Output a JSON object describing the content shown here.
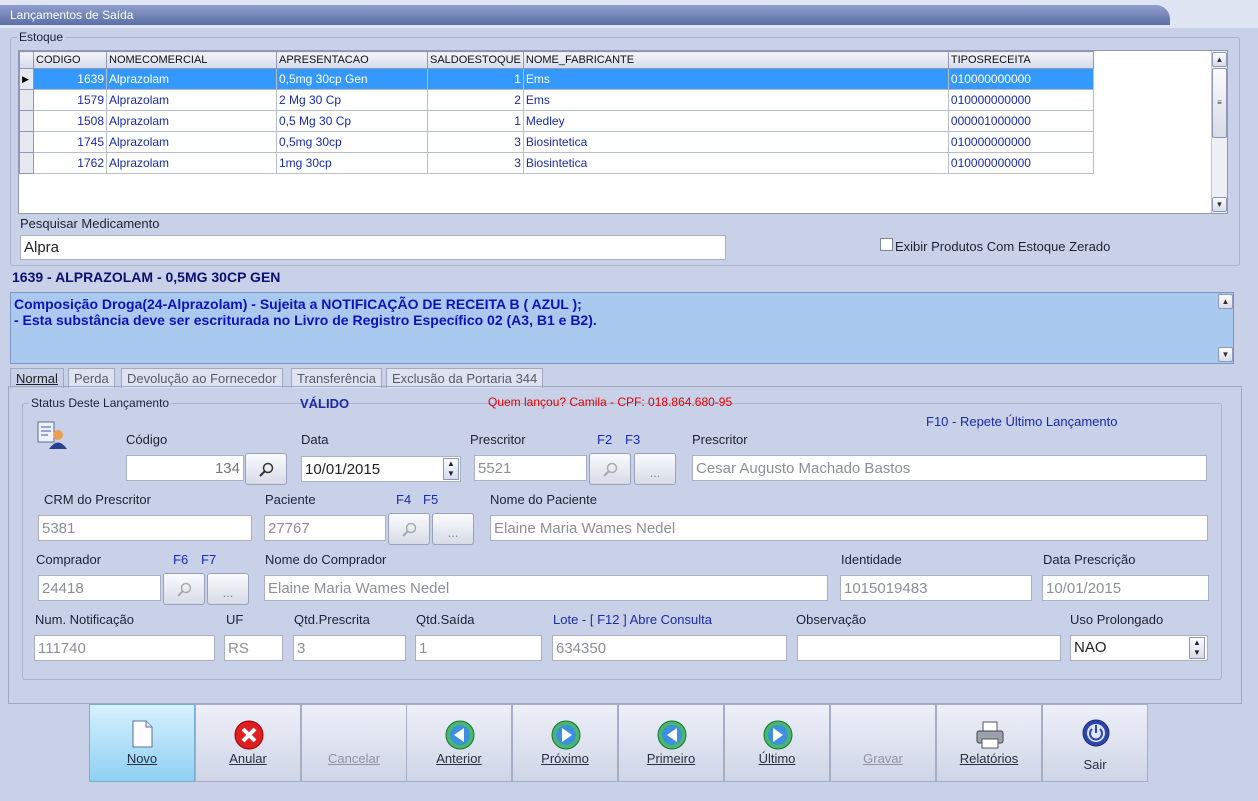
{
  "window": {
    "title": "Lançamentos de Saída"
  },
  "estoque": {
    "legend": "Estoque",
    "columns": [
      "CODIGO",
      "NOMECOMERCIAL",
      "APRESENTACAO",
      "SALDOESTOQUE",
      "NOME_FABRICANTE",
      "TIPOSRECEITA"
    ],
    "rows": [
      [
        "1639",
        "Alprazolam",
        "0,5mg 30cp Gen",
        "1",
        "Ems",
        "010000000000"
      ],
      [
        "1579",
        "Alprazolam",
        "2 Mg 30 Cp",
        "2",
        "Ems",
        "010000000000"
      ],
      [
        "1508",
        "Alprazolam",
        "0,5 Mg 30 Cp",
        "1",
        "Medley",
        "000001000000"
      ],
      [
        "1745",
        "Alprazolam",
        "0,5mg 30cp",
        "3",
        "Biosintetica",
        "010000000000"
      ],
      [
        "1762",
        "Alprazolam",
        "1mg 30cp",
        "3",
        "Biosintetica",
        "010000000000"
      ]
    ],
    "selected_row": 0,
    "search_label": "Pesquisar Medicamento",
    "search_value": "Alpra",
    "zero_stock_label": "Exibir Produtos Com Estoque Zerado",
    "zero_stock_checked": false
  },
  "selected_product": "1639 - ALPRAZOLAM - 0,5MG 30CP GEN",
  "info_lines": [
    "Composição Droga(24-Alprazolam) - Sujeita a NOTIFICAÇÃO DE RECEITA B ( AZUL );",
    "- Esta substância deve ser escriturada no Livro de Registro Específico 02 (A3, B1 e B2)."
  ],
  "tabs": [
    "Normal",
    "Perda",
    "Devolução ao Fornecedor",
    "Transferência",
    "Exclusão da Portaria 344"
  ],
  "active_tab": "Normal",
  "form": {
    "status_label": "Status Deste Lançamento",
    "status_value": "VÁLIDO",
    "quem_lancou": "Quem lançou? Camila - CPF: 018.864.680-95",
    "repete_hint": "F10 - Repete Último Lançamento",
    "codigo_label": "Código",
    "codigo": "134",
    "data_label": "Data",
    "data": "10/01/2015",
    "prescritor_label": "Prescritor",
    "prescritor_code": "5521",
    "f2": "F2",
    "f3": "F3",
    "prescritor_nome_label": "Prescritor",
    "prescritor_nome": "Cesar Augusto Machado Bastos",
    "crm_label": "CRM do Prescritor",
    "crm": "5381",
    "paciente_label": "Paciente",
    "paciente_code": "27767",
    "f4": "F4",
    "f5": "F5",
    "nome_paciente_label": "Nome do Paciente",
    "nome_paciente": "Elaine Maria Wames Nedel",
    "comprador_label": "Comprador",
    "comprador_code": "24418",
    "f6": "F6",
    "f7": "F7",
    "nome_comprador_label": "Nome do Comprador",
    "nome_comprador": "Elaine Maria Wames Nedel",
    "identidade_label": "Identidade",
    "identidade": "1015019483",
    "data_prescricao_label": "Data Prescrição",
    "data_prescricao": "10/01/2015",
    "num_notificacao_label": "Num. Notificação",
    "num_notificacao": "111740",
    "uf_label": "UF",
    "uf": "RS",
    "qtd_prescrita_label": "Qtd.Prescrita",
    "qtd_prescrita": "3",
    "qtd_saida_label": "Qtd.Saída",
    "qtd_saida": "1",
    "lote_label": "Lote - [ F12 ] Abre Consulta",
    "lote": "634350",
    "observacao_label": "Observação",
    "observacao": "",
    "uso_prolongado_label": "Uso Prolongado",
    "uso_prolongado": "NAO",
    "lookup_button_text": "..."
  },
  "toolbar": {
    "novo": "Novo",
    "anular": "Anular",
    "cancelar": "Cancelar",
    "anterior": "Anterior",
    "proximo": "Próximo",
    "primeiro": "Primeiro",
    "ultimo": "Último",
    "gravar": "Gravar",
    "relatorios": "Relatórios",
    "sair": "Sair"
  },
  "colors": {
    "accent": "#3399ff",
    "info_bg": "#a9c9ef",
    "link_blue": "#1a2aa8",
    "alert_red": "#e00000"
  }
}
